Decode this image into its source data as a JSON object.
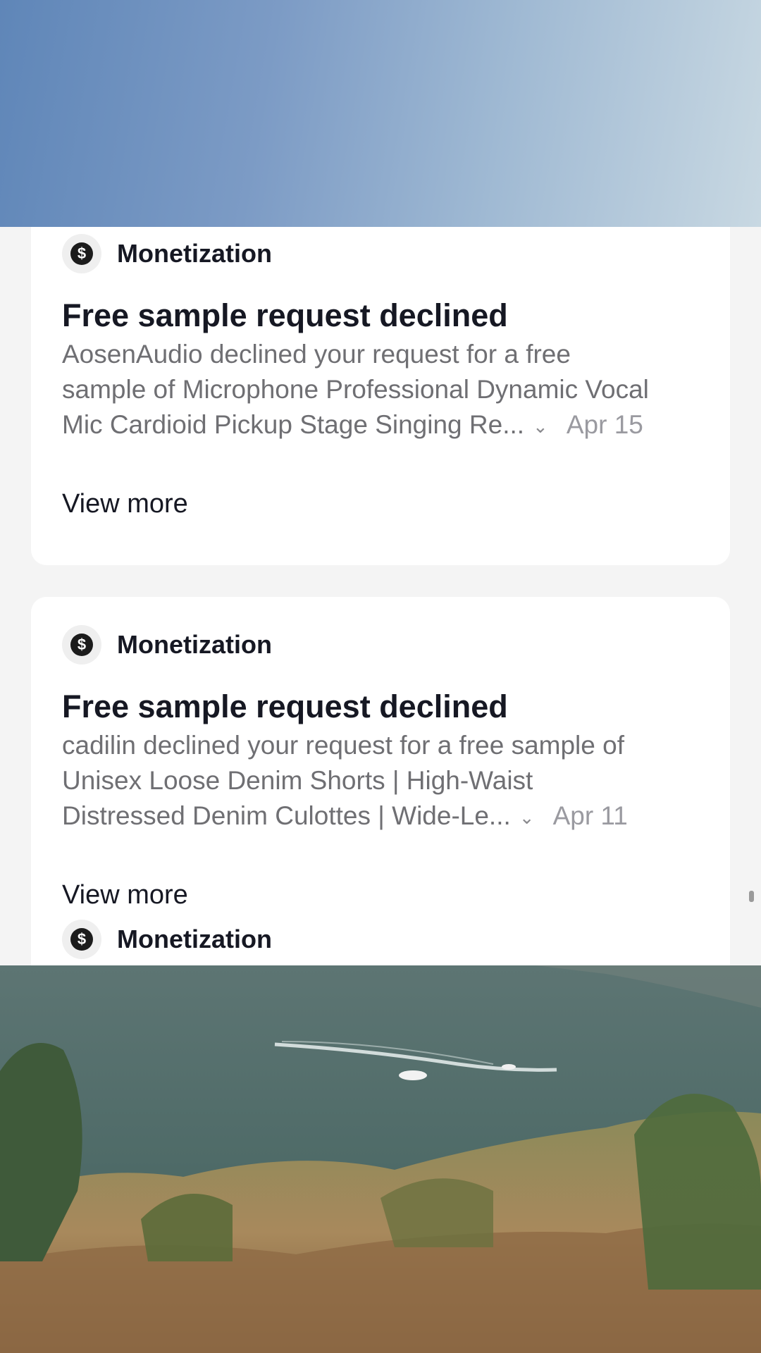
{
  "notifications": [
    {
      "category": "Monetization",
      "title": "Free sample request declined",
      "body_lines": [
        "AosenAudio declined your request for a free",
        "sample of Microphone Professional Dynamic Vocal",
        "Mic Cardioid Pickup Stage Singing Re..."
      ],
      "date": "Apr 15",
      "view_more": "View more"
    },
    {
      "category": "Monetization",
      "title": "Free sample request declined",
      "body_lines": [
        "cadilin declined your request for a free sample of",
        "Unisex Loose Denim Shorts  |  High-Waist",
        "Distressed Denim Culottes  |  Wide-Le..."
      ],
      "date": "Apr 11",
      "view_more": "View more"
    },
    {
      "category": "Monetization"
    }
  ],
  "icons": {
    "category": "dollar-icon",
    "expand": "chevron-down-icon"
  },
  "glyphs": {
    "dollar": "$",
    "chevron": "⌄"
  }
}
